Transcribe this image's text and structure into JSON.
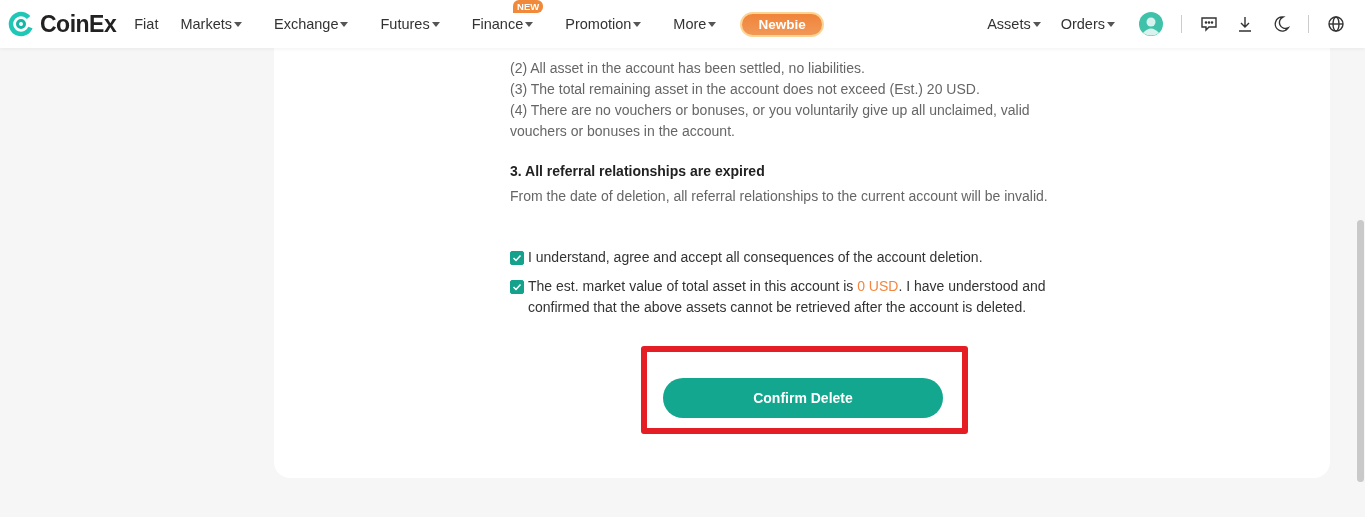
{
  "header": {
    "logo": "CoinEx",
    "nav": [
      {
        "label": "Fiat",
        "dropdown": false
      },
      {
        "label": "Markets",
        "dropdown": true
      },
      {
        "label": "Exchange",
        "dropdown": true
      },
      {
        "label": "Futures",
        "dropdown": true
      },
      {
        "label": "Finance",
        "dropdown": true,
        "badge": "NEW"
      },
      {
        "label": "Promotion",
        "dropdown": true
      },
      {
        "label": "More",
        "dropdown": true
      }
    ],
    "cta": "Newbie",
    "right_nav": [
      {
        "label": "Assets",
        "dropdown": true
      },
      {
        "label": "Orders",
        "dropdown": true
      }
    ]
  },
  "conditions": [
    "(2) All asset in the account has been settled, no liabilities.",
    "(3) The total remaining asset in the account does not exceed (Est.) 20 USD.",
    "(4) There are no vouchers or bonuses, or you voluntarily give up all unclaimed, valid vouchers or bonuses in the account."
  ],
  "section": {
    "title": "3. All referral relationships are expired",
    "text": "From the date of deletion, all referral relationships to the current account will be invalid."
  },
  "agreements": [
    {
      "checked": true,
      "text": "I understand, agree and accept all consequences of the account deletion."
    },
    {
      "checked": true,
      "text": "The est. market value of total asset in this account is ",
      "amount": "0 USD",
      "after": ". I have understood and confirmed that the above assets cannot be retrieved after the account is deleted."
    }
  ],
  "confirm_button": "Confirm Delete"
}
